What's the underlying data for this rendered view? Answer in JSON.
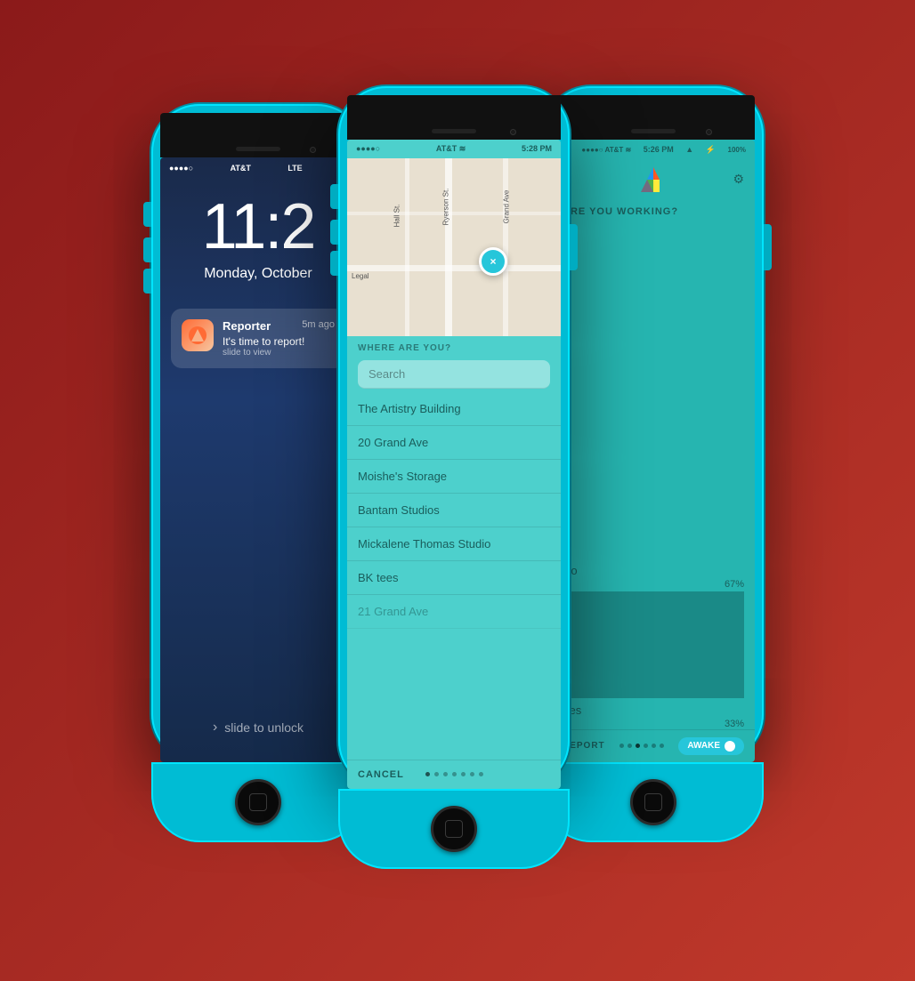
{
  "phones": {
    "phone1": {
      "type": "lockscreen",
      "status": {
        "signal": "●●●●○",
        "carrier": "AT&T",
        "network": "LTE",
        "location": "▲"
      },
      "time": "11:2",
      "date": "Monday, October",
      "notification": {
        "app": "Reporter",
        "time_ago": "5m ago",
        "title": "It's time to report!",
        "subtitle": "slide to view"
      },
      "slide_text": "slide to unlock"
    },
    "phone2": {
      "type": "location",
      "status": {
        "signal": "●●●●○",
        "carrier": "AT&T",
        "wifi": true,
        "time": "5:28 PM"
      },
      "section_label": "WHERE ARE YOU?",
      "search_placeholder": "Search",
      "locations": [
        "The Artistry Building",
        "20 Grand Ave",
        "Moishe's Storage",
        "Bantam Studios",
        "Mickalene Thomas Studio",
        "BK tees",
        "21 Grand Ave"
      ],
      "cancel_label": "CANCEL",
      "dots": 7,
      "active_dot": 0
    },
    "phone3": {
      "type": "working",
      "status": {
        "signal": "●●●●○",
        "carrier": "AT&T",
        "wifi": true,
        "time": "5:26 PM",
        "location": true,
        "bluetooth": true,
        "battery": "100%"
      },
      "question": "ARE YOU WORKING?",
      "no_label": "No",
      "no_percent": "67%",
      "yes_label": "Yes",
      "yes_percent": "33%",
      "report_label": "REPORT",
      "awake_label": "AWAKE",
      "dots": 6,
      "active_dot": 2
    }
  }
}
